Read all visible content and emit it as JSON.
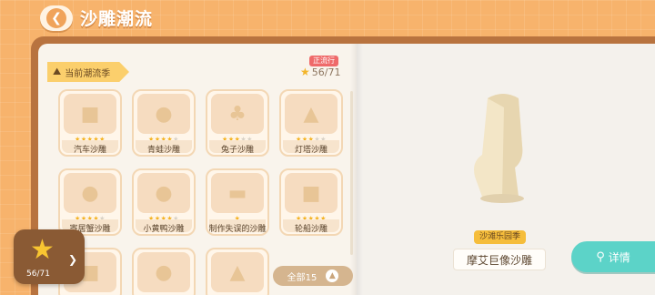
{
  "header": {
    "title": "沙雕潮流",
    "back_icon": "chevron-left-icon"
  },
  "season_section": {
    "tab_label": "当前潮流季",
    "badge": "正流行",
    "progress": "56/71"
  },
  "cards": [
    {
      "name": "汽车沙雕",
      "stars": 5,
      "max": 5
    },
    {
      "name": "青蛙沙雕",
      "stars": 4,
      "max": 5
    },
    {
      "name": "兔子沙雕",
      "stars": 3,
      "max": 5
    },
    {
      "name": "灯塔沙雕",
      "stars": 3,
      "max": 5
    },
    {
      "name": "寄居蟹沙雕",
      "stars": 4,
      "max": 5
    },
    {
      "name": "小黄鸭沙雕",
      "stars": 4,
      "max": 5
    },
    {
      "name": "制作失误的沙雕",
      "stars": 1,
      "max": 1
    },
    {
      "name": "轮船沙雕",
      "stars": 5,
      "max": 5
    }
  ],
  "all_button": {
    "label": "全部15"
  },
  "star_widget": {
    "count": "56/71"
  },
  "preview": {
    "season_name": "沙滩乐园季",
    "item_name": "摩艾巨像沙雕"
  },
  "detail_button": {
    "label": "详情"
  },
  "colors": {
    "accent": "#5cd3c8",
    "star": "#f5b322",
    "background": "#f7b36c"
  }
}
